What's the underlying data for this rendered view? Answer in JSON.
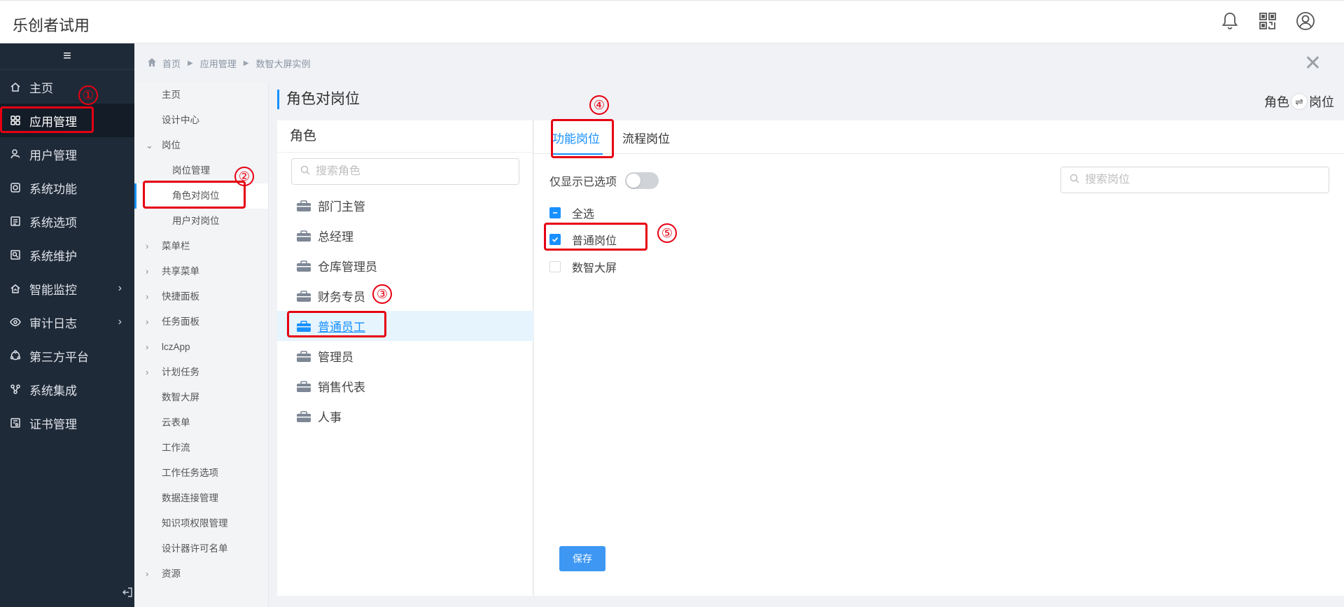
{
  "app": {
    "title": "乐创者试用"
  },
  "header_icons": [
    "bell-icon",
    "qrcode-icon",
    "user-circle-icon"
  ],
  "sidebar": {
    "menu_icon": "≡",
    "items": [
      {
        "label": "主页",
        "icon": "home-icon"
      },
      {
        "label": "应用管理",
        "icon": "apps-icon",
        "active": true
      },
      {
        "label": "用户管理",
        "icon": "user-icon"
      },
      {
        "label": "系统功能",
        "icon": "system-icon"
      },
      {
        "label": "系统选项",
        "icon": "list-icon"
      },
      {
        "label": "系统维护",
        "icon": "maintain-icon"
      },
      {
        "label": "智能监控",
        "icon": "monitor-icon",
        "expandable": true
      },
      {
        "label": "审计日志",
        "icon": "eye-icon",
        "expandable": true
      },
      {
        "label": "第三方平台",
        "icon": "platform-icon"
      },
      {
        "label": "系统集成",
        "icon": "integration-icon"
      },
      {
        "label": "证书管理",
        "icon": "cert-icon"
      }
    ]
  },
  "breadcrumb": {
    "items": [
      "首页",
      "应用管理",
      "数智大屏实例"
    ]
  },
  "subnav": {
    "items": [
      {
        "label": "主页",
        "level": 1
      },
      {
        "label": "设计中心",
        "level": 1
      },
      {
        "label": "岗位",
        "level": 1,
        "caret": "open"
      },
      {
        "label": "岗位管理",
        "level": 2
      },
      {
        "label": "角色对岗位",
        "level": 2,
        "active": true
      },
      {
        "label": "用户对岗位",
        "level": 2
      },
      {
        "label": "菜单栏",
        "level": 1,
        "caret": "closed"
      },
      {
        "label": "共享菜单",
        "level": 1,
        "caret": "closed"
      },
      {
        "label": "快捷面板",
        "level": 1,
        "caret": "closed"
      },
      {
        "label": "任务面板",
        "level": 1,
        "caret": "closed"
      },
      {
        "label": "lczApp",
        "level": 1,
        "caret": "closed"
      },
      {
        "label": "计划任务",
        "level": 1,
        "caret": "closed"
      },
      {
        "label": "数智大屏",
        "level": 1
      },
      {
        "label": "云表单",
        "level": 1
      },
      {
        "label": "工作流",
        "level": 1
      },
      {
        "label": "工作任务选项",
        "level": 1
      },
      {
        "label": "数据连接管理",
        "level": 1
      },
      {
        "label": "知识项权限管理",
        "level": 1
      },
      {
        "label": "设计器许可名单",
        "level": 1
      },
      {
        "label": "资源",
        "level": 1,
        "caret": "closed"
      }
    ]
  },
  "page": {
    "title": "角色对岗位",
    "switch_left": "角色",
    "switch_icon": "⇌",
    "switch_right": "岗位"
  },
  "roles": {
    "header": "角色",
    "search_placeholder": "搜索角色",
    "items": [
      "部门主管",
      "总经理",
      "仓库管理员",
      "财务专员",
      "普通员工",
      "管理员",
      "销售代表",
      "人事"
    ],
    "selected": "普通员工"
  },
  "posts": {
    "tabs": [
      "功能岗位",
      "流程岗位"
    ],
    "active_tab": "功能岗位",
    "toggle_label": "仅显示已选项",
    "toggle_on": false,
    "search_placeholder": "搜索岗位",
    "select_all": "全选",
    "items": [
      {
        "label": "普通岗位",
        "checked": true
      },
      {
        "label": "数智大屏",
        "checked": false
      }
    ],
    "save_label": "保存"
  },
  "annotations": [
    "①",
    "②",
    "③",
    "④",
    "⑤"
  ],
  "colors": {
    "accent": "#1890ff",
    "sidebar_bg": "#1f2a38",
    "annotation_red": "#e60012",
    "save_button": "#3d97f3"
  }
}
